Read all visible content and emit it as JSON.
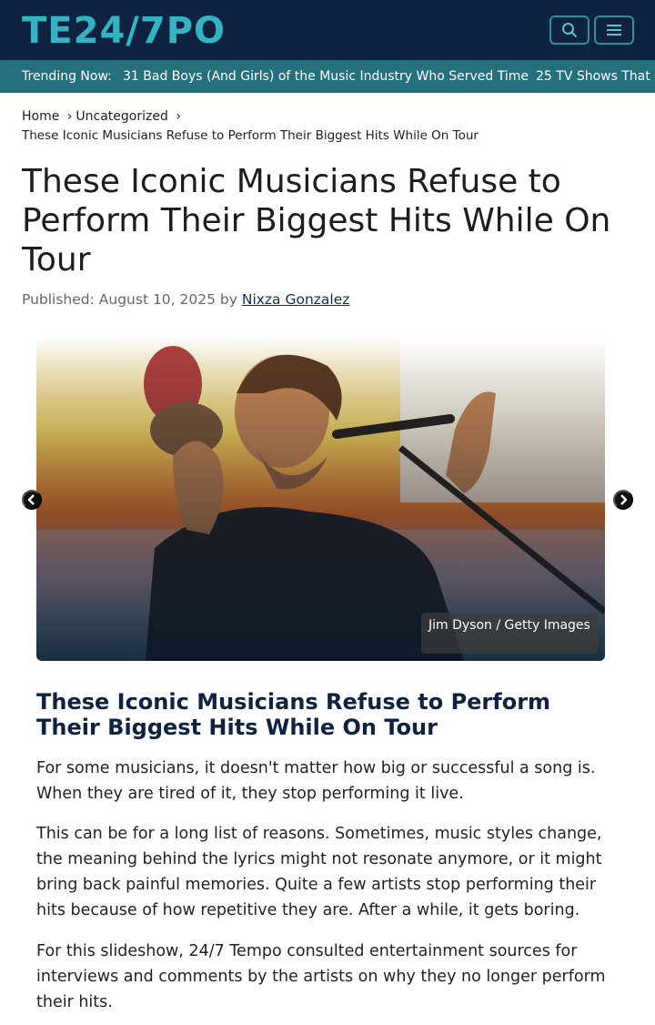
{
  "brand": {
    "logo_text": "TE24/7PO",
    "accent_color": "#34b3c2",
    "header_bg": "#0f2340"
  },
  "header": {
    "search_icon": "search-icon",
    "menu_icon": "hamburger-menu-icon"
  },
  "trending": {
    "label": "Trending Now:",
    "items": [
      "31 Bad Boys (And Girls) of the Music Industry Who Served Time",
      "25 TV Shows That"
    ],
    "bar_color": "#24707d"
  },
  "breadcrumb": {
    "home": "Home",
    "separator": "›",
    "category": "Uncategorized",
    "current": "These Iconic Musicians Refuse to Perform Their Biggest Hits While On Tour"
  },
  "article": {
    "title": "These Iconic Musicians Refuse to Perform Their Biggest Hits While On Tour",
    "published_label": "Published: August 10, 2025 by",
    "author": "Nixza Gonzalez"
  },
  "slideshow": {
    "image_credit": "Jim Dyson / Getty Images",
    "prev_icon": "chevron-left-icon",
    "next_icon": "chevron-right-icon"
  },
  "content": {
    "subhead": "These Iconic Musicians Refuse to Perform Their Biggest Hits While On Tour",
    "paragraphs": [
      "For some musicians, it doesn't matter how big or successful a song is. When they are tired of it, they stop performing it live.",
      "This can be for a long list of reasons. Sometimes, music styles change, the meaning behind the lyrics might not resonate anymore, or it might bring back painful memories. Quite a few artists stop performing their hits because of how repetitive they are. After a while, it gets boring.",
      "For this slideshow, 24/7 Tempo consulted entertainment sources for interviews and comments by the artists on why they no longer perform their hits."
    ]
  }
}
